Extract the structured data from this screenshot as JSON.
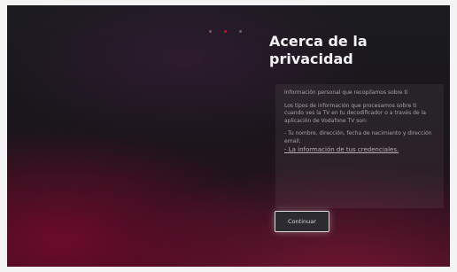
{
  "screen": {
    "title": "Acerca de la privacidad",
    "pagination": {
      "total": 3,
      "active_index": 1,
      "active_color": "#e6002a",
      "inactive_color": "#7a5c66"
    },
    "info": {
      "intro": "Información personal que recopilamos sobre ti",
      "body": "Los tipos de información que procesamos sobre ti cuando ves la TV en tu decodificador o a través de la aplicación de Vodafone TV son:",
      "item_1": "- Tu nombre, dirección, fecha de nacimiento y dirección email;",
      "item_2": "- La información de tus credenciales."
    },
    "continue_button": "Continuar"
  },
  "colors": {
    "background_dark": "#1b1b1f",
    "accent_red": "#e6002a"
  }
}
